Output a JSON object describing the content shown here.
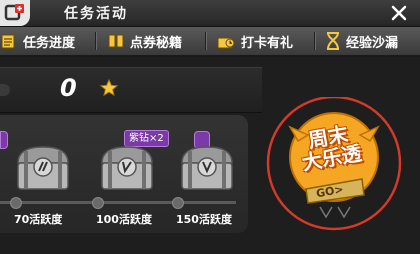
{
  "title": "任务活动",
  "tabs": [
    {
      "label": "任务进度",
      "icon": "task-clipboard-icon"
    },
    {
      "label": "点券秘籍",
      "icon": "book-icon"
    },
    {
      "label": "打卡有礼",
      "icon": "gift-icon"
    },
    {
      "label": "经验沙漏",
      "icon": "hourglass-icon"
    }
  ],
  "points": {
    "value": "0",
    "icon": "star-icon"
  },
  "rewards": [
    {
      "label": "70活跃度"
    },
    {
      "label": "100活跃度",
      "badge": "紫钻×2"
    },
    {
      "label": "150活跃度"
    }
  ],
  "lottery": {
    "line1": "周末",
    "line2": "大乐透",
    "go": "GO>"
  },
  "colors": {
    "accent": "#f5a623",
    "highlight_circle": "#d23a2a",
    "badge_purple": "#7c3aa8"
  }
}
